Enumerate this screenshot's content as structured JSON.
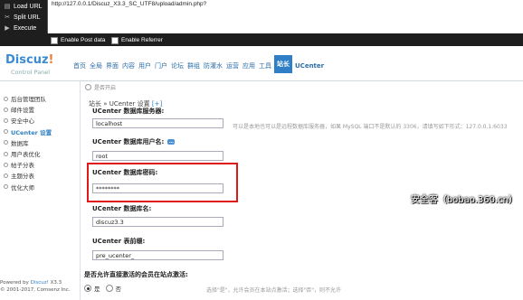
{
  "hackbar": {
    "menu": [
      "Load URL",
      "Split URL",
      "Execute"
    ],
    "url": "http://127.0.0.1/Discuz_X3.3_SC_UTF8/upload/admin.php?",
    "options": [
      "Enable Post data",
      "Enable Referrer"
    ]
  },
  "logo": {
    "brand": "Discuz",
    "bang": "!",
    "sub": "Control Panel"
  },
  "nav": [
    "首页",
    "全局",
    "界面",
    "内容",
    "用户",
    "门户",
    "论坛",
    "群组",
    "防灌水",
    "运营",
    "应用",
    "工具",
    "站长",
    "UCenter"
  ],
  "nav_active": "站长",
  "sidebar": {
    "items": [
      "后台管理团队",
      "邮件设置",
      "安全中心",
      "UCenter 设置",
      "数据库",
      "用户表优化",
      "帖子分表",
      "主题分表",
      "优化大师"
    ],
    "active": "UCenter 设置",
    "footer_line1_prefix": "Powered by ",
    "footer_brand": "Discuz!",
    "footer_version": " X3.3",
    "footer_line2": "© 2001-2017, Comsenz Inc."
  },
  "main": {
    "prev_option": "是否开启",
    "breadcrumb_prefix": "站长 » UCenter 设置",
    "breadcrumb_plus": "[+]",
    "fields": [
      {
        "label": "UCenter 数据库服务器:",
        "value": "localhost"
      },
      {
        "label": "UCenter 数据库用户名:",
        "value": "root"
      },
      {
        "label": "UCenter 数据库密码:",
        "value": "********"
      },
      {
        "label": "UCenter 数据库名:",
        "value": "discuz3.3"
      },
      {
        "label": "UCenter 表前缀:",
        "value": "pre_ucenter_"
      }
    ],
    "server_hint": "可以是本地也可以是远程数据库服务器，如果 MySQL 端口不是默认的 3306，请填写如下形式：127.0.0.1:6033",
    "activate_label": "是否允许直接激活的会员在站点激活:",
    "radio_options": [
      "是",
      "否"
    ],
    "bottom_hint": "选择\"是\"，允许会员在本站点激活；选择\"否\"，则不允许"
  },
  "watermark": "安全客（bobao.360.cn）"
}
